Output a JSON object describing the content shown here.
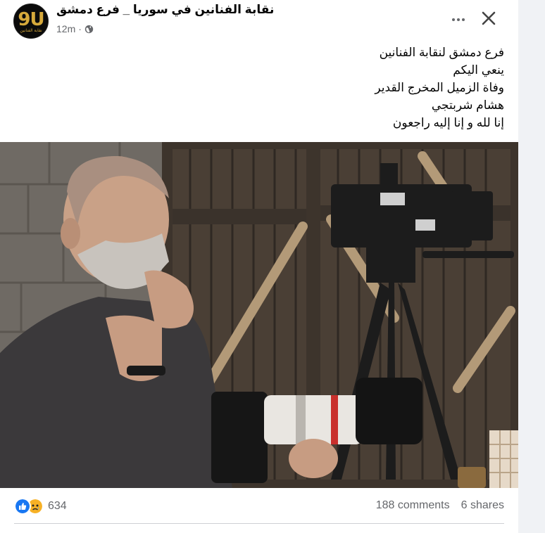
{
  "post": {
    "page_name": "نقابة الفنانين في سوريا _ فرع دمشق",
    "time": "12m",
    "separator": "·",
    "privacy_icon": "globe-icon",
    "avatar_text": "9U",
    "avatar_sub": "نقابة الفنانين",
    "text_lines": [
      "فرع دمشق لنقابة الفنانين",
      "ينعي اليكم",
      "وفاة الزميل المخرج القدير",
      "هشام شربتجي",
      "إنا لله و إنا إليه راجعون"
    ]
  },
  "footer": {
    "reaction_icons": [
      "like-icon",
      "sad-icon"
    ],
    "reaction_count": "634",
    "comments": "188 comments",
    "shares": "6 shares"
  },
  "colors": {
    "like": "#1877f2",
    "sad": "#f7b125",
    "secondary_text": "#65676b",
    "avatar_gold": "#d6a93b"
  }
}
